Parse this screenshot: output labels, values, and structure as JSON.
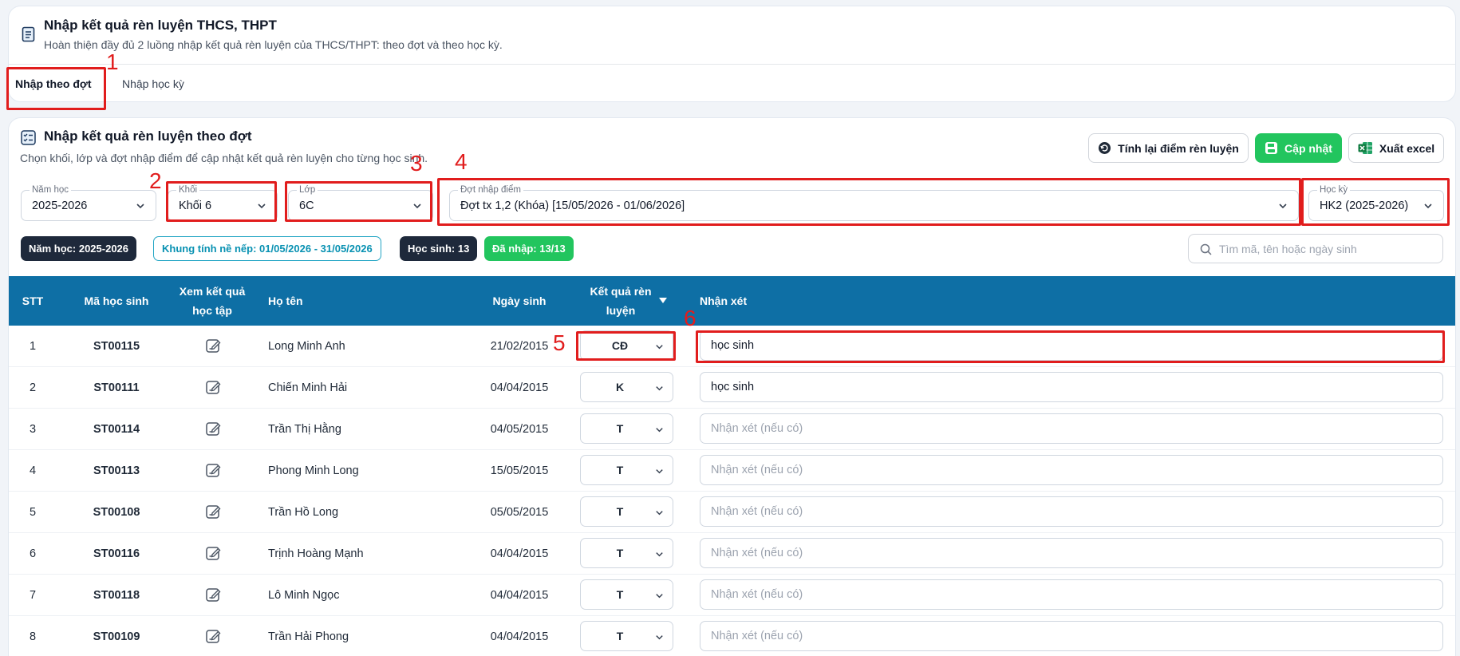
{
  "header": {
    "title": "Nhập kết quả rèn luyện THCS, THPT",
    "subtitle": "Hoàn thiện đầy đủ 2 luồng nhập kết quả rèn luyện của THCS/THPT: theo đợt và theo học kỳ.",
    "tabs": [
      {
        "label": "Nhập theo đợt",
        "active": true
      },
      {
        "label": "Nhập học kỳ",
        "active": false
      }
    ]
  },
  "section": {
    "title": "Nhập kết quả rèn luyện theo đợt",
    "subtitle": "Chọn khối, lớp và đợt nhập điểm để cập nhật kết quả rèn luyện cho từng học sinh.",
    "buttons": {
      "recalc": "Tính lại điểm rèn luyện",
      "update": "Cập nhật",
      "export": "Xuất excel"
    }
  },
  "filters": {
    "nam_hoc": {
      "label": "Năm học",
      "value": "2025-2026"
    },
    "khoi": {
      "label": "Khối",
      "value": "Khối 6"
    },
    "lop": {
      "label": "Lớp",
      "value": "6C"
    },
    "dot_nhap_diem": {
      "label": "Đợt nhập điểm",
      "value": "Đợt tx 1,2 (Khóa) [15/05/2026 - 01/06/2026]"
    },
    "hoc_ky": {
      "label": "Học kỳ",
      "value": "HK2 (2025-2026)"
    }
  },
  "badges": {
    "nam_hoc": "Năm học: 2025-2026",
    "khung": "Khung tính nề nếp: 01/05/2026 - 31/05/2026",
    "hoc_sinh": "Học sinh: 13",
    "da_nhap": "Đã nhập: 13/13"
  },
  "search": {
    "placeholder": "Tìm mã, tên hoặc ngày sinh",
    "value": ""
  },
  "table": {
    "columns": {
      "stt": "STT",
      "ma": "Mã học sinh",
      "xem_line1": "Xem kết quả",
      "xem_line2": "học tập",
      "ho_ten": "Họ tên",
      "ngay_sinh": "Ngày sinh",
      "ket_qua_line1": "Kết quả rèn",
      "ket_qua_line2": "luyện",
      "nhan_xet": "Nhận xét"
    },
    "comment_placeholder": "Nhận xét (nếu có)",
    "rows": [
      {
        "stt": "1",
        "ma": "ST00115",
        "ho_ten": "Long Minh Anh",
        "ngay_sinh": "21/02/2015",
        "ket_qua": "CĐ",
        "nhan_xet": "học sinh"
      },
      {
        "stt": "2",
        "ma": "ST00111",
        "ho_ten": "Chiến Minh Hải",
        "ngay_sinh": "04/04/2015",
        "ket_qua": "K",
        "nhan_xet": "học sinh"
      },
      {
        "stt": "3",
        "ma": "ST00114",
        "ho_ten": "Trần Thị Hằng",
        "ngay_sinh": "04/05/2015",
        "ket_qua": "T",
        "nhan_xet": ""
      },
      {
        "stt": "4",
        "ma": "ST00113",
        "ho_ten": "Phong Minh Long",
        "ngay_sinh": "15/05/2015",
        "ket_qua": "T",
        "nhan_xet": ""
      },
      {
        "stt": "5",
        "ma": "ST00108",
        "ho_ten": "Trần Hồ Long",
        "ngay_sinh": "05/05/2015",
        "ket_qua": "T",
        "nhan_xet": ""
      },
      {
        "stt": "6",
        "ma": "ST00116",
        "ho_ten": "Trịnh Hoàng Mạnh",
        "ngay_sinh": "04/04/2015",
        "ket_qua": "T",
        "nhan_xet": ""
      },
      {
        "stt": "7",
        "ma": "ST00118",
        "ho_ten": "Lô Minh Ngọc",
        "ngay_sinh": "04/04/2015",
        "ket_qua": "T",
        "nhan_xet": ""
      },
      {
        "stt": "8",
        "ma": "ST00109",
        "ho_ten": "Trần Hải Phong",
        "ngay_sinh": "04/04/2015",
        "ket_qua": "T",
        "nhan_xet": ""
      }
    ]
  },
  "annotations": [
    "1",
    "2",
    "3",
    "4",
    "5",
    "6"
  ],
  "colors": {
    "header_bg": "#0e6fa5",
    "primary_green": "#22c55e",
    "dark_badge": "#1e293b",
    "annotation_red": "#e11d1d"
  }
}
